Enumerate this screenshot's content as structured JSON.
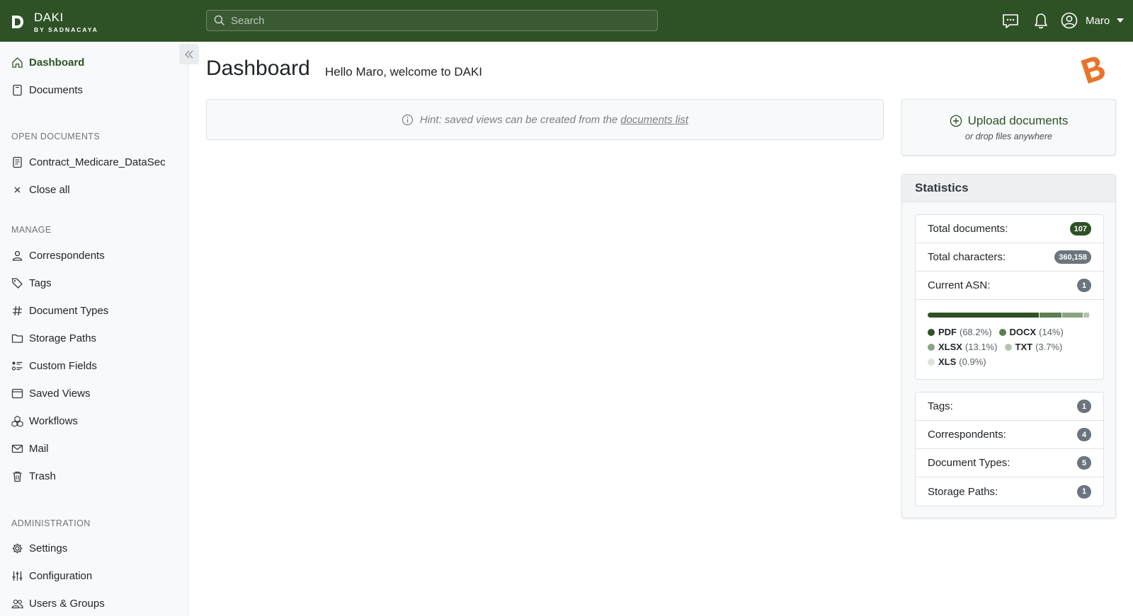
{
  "app": {
    "name": "DAKI",
    "subtitle": "BY SADNACAYA",
    "search_placeholder": "Search"
  },
  "user": {
    "name": "Maro"
  },
  "sidebar": {
    "main_items": [
      {
        "label": "Dashboard",
        "icon": "house-icon",
        "active": true
      },
      {
        "label": "Documents",
        "icon": "document-icon"
      }
    ],
    "open_documents_title": "OPEN DOCUMENTS",
    "open_documents": [
      {
        "label": "Contract_Medicare_DataSec",
        "icon": "file-text-icon"
      },
      {
        "label": "Close all",
        "icon": "close-icon"
      }
    ],
    "manage_title": "MANAGE",
    "manage_items": [
      {
        "label": "Correspondents",
        "icon": "person-icon"
      },
      {
        "label": "Tags",
        "icon": "tags-icon"
      },
      {
        "label": "Document Types",
        "icon": "hash-icon"
      },
      {
        "label": "Storage Paths",
        "icon": "folder-icon"
      },
      {
        "label": "Custom Fields",
        "icon": "ui-radios-icon"
      },
      {
        "label": "Saved Views",
        "icon": "window-stack-icon"
      },
      {
        "label": "Workflows",
        "icon": "boxes-icon"
      },
      {
        "label": "Mail",
        "icon": "envelope-icon"
      },
      {
        "label": "Trash",
        "icon": "trash-icon"
      }
    ],
    "admin_title": "ADMINISTRATION",
    "admin_items": [
      {
        "label": "Settings",
        "icon": "gear-icon"
      },
      {
        "label": "Configuration",
        "icon": "sliders-icon"
      },
      {
        "label": "Users & Groups",
        "icon": "people-icon"
      }
    ]
  },
  "main": {
    "title": "Dashboard",
    "welcome": "Hello Maro, welcome to DAKI",
    "hint_text": "Hint: saved views can be created from the",
    "hint_link": "documents list"
  },
  "upload": {
    "label": "Upload documents",
    "sub": "or drop files anywhere"
  },
  "statistics": {
    "title": "Statistics",
    "top_rows": [
      {
        "label": "Total documents:",
        "value": "107",
        "style": "green"
      },
      {
        "label": "Total characters:",
        "value": "360,158",
        "style": "gray"
      },
      {
        "label": "Current ASN:",
        "value": "1",
        "style": "gray"
      }
    ],
    "file_types": [
      {
        "name": "PDF",
        "percent": "(68.2%)",
        "share": 68.2,
        "color": "#2e5226"
      },
      {
        "name": "DOCX",
        "percent": "(14%)",
        "share": 14,
        "color": "#5b7e52"
      },
      {
        "name": "XLSX",
        "percent": "(13.1%)",
        "share": 13.1,
        "color": "#8aa482"
      },
      {
        "name": "TXT",
        "percent": "(3.7%)",
        "share": 3.7,
        "color": "#b5c4b0"
      },
      {
        "name": "XLS",
        "percent": "(0.9%)",
        "share": 0.9,
        "color": "#dce3da"
      }
    ],
    "bottom_rows": [
      {
        "label": "Tags:",
        "value": "1"
      },
      {
        "label": "Correspondents:",
        "value": "4"
      },
      {
        "label": "Document Types:",
        "value": "5"
      },
      {
        "label": "Storage Paths:",
        "value": "1"
      }
    ]
  },
  "colors": {
    "brand": "#2e5226",
    "accent_orange": "#e8742a"
  }
}
